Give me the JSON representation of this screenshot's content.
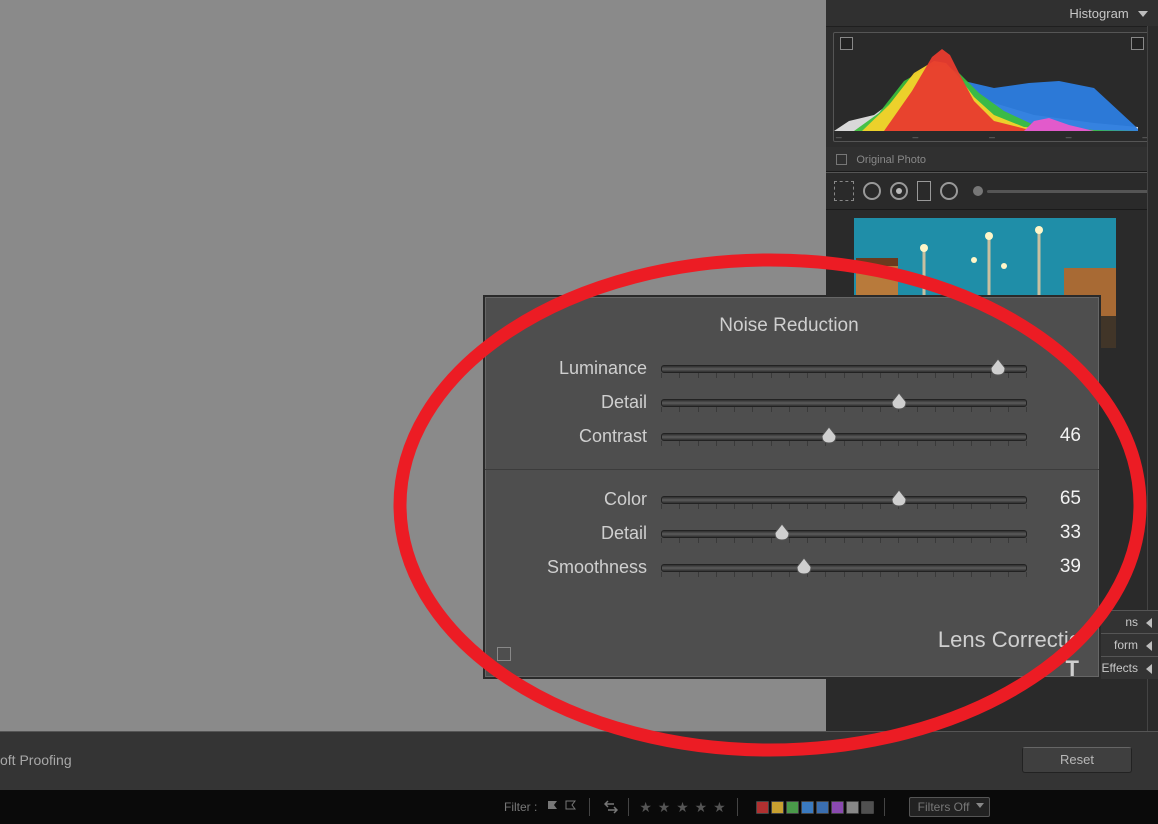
{
  "right_panel": {
    "histogram_label": "Histogram",
    "original_photo_label": "Original Photo"
  },
  "noise_reduction": {
    "title": "Noise Reduction",
    "sliders": [
      {
        "label": "Luminance",
        "value": "",
        "pos": 92
      },
      {
        "label": "Detail",
        "value": "",
        "pos": 65
      },
      {
        "label": "Contrast",
        "value": "46",
        "pos": 46
      }
    ],
    "sliders2": [
      {
        "label": "Color",
        "value": "65",
        "pos": 65
      },
      {
        "label": "Detail",
        "value": "33",
        "pos": 33
      },
      {
        "label": "Smoothness",
        "value": "39",
        "pos": 39
      }
    ],
    "lens_label": "Lens Correctio"
  },
  "side_panels": [
    {
      "label": "ns"
    },
    {
      "label": "form"
    },
    {
      "label": "Effects"
    }
  ],
  "bottom": {
    "soft_proofing": "oft Proofing",
    "reset": "Reset"
  },
  "filmstrip": {
    "filter_label": "Filter :",
    "filters_off": "Filters Off",
    "swatches": [
      "#b03030",
      "#c8a030",
      "#4a9a4a",
      "#3a7ac0",
      "#3a6eb0",
      "#8a4ab0",
      "#888",
      "#505050"
    ]
  }
}
